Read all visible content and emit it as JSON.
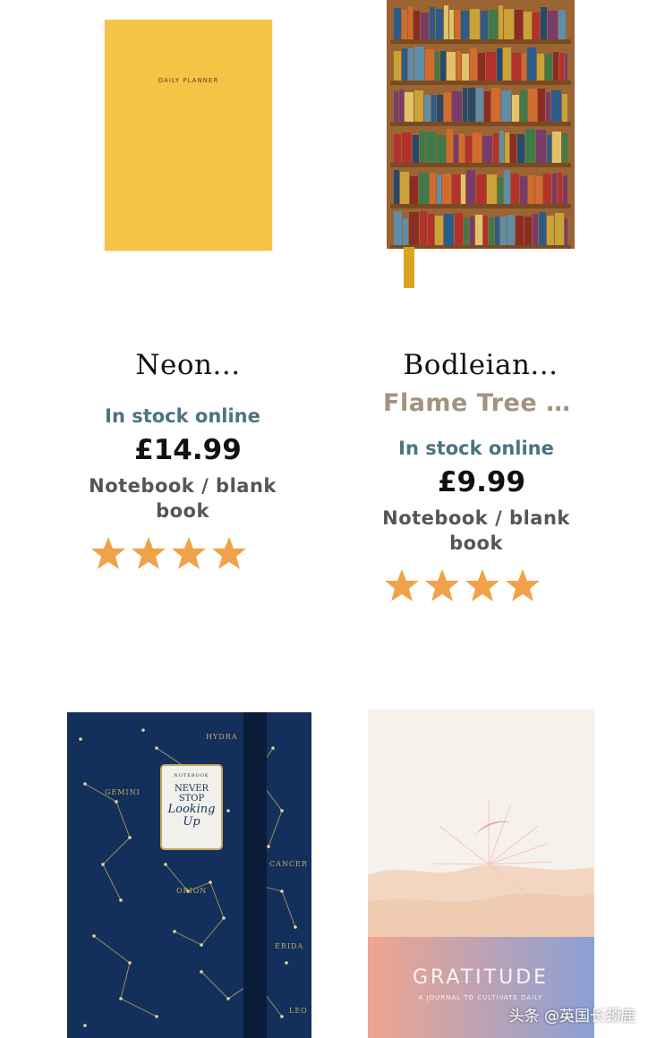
{
  "products": [
    {
      "title": "Neon...",
      "author": "",
      "stock": "In stock online",
      "price": "£14.99",
      "format": "Notebook / blank book",
      "rating": 4.5,
      "cover_text": "DAILY PLANNER"
    },
    {
      "title": "Bodleian...",
      "author": "Flame Tree St…",
      "stock": "In stock online",
      "price": "£9.99",
      "format": "Notebook / blank book",
      "rating": 4.5
    },
    {
      "cover_lines": [
        "NOTEBOOK",
        "NEVER",
        "STOP",
        "Looking",
        "Up"
      ],
      "constellations": [
        "HYDRA",
        "GEMINI",
        "CANCER",
        "ORION",
        "ERIDA",
        "LEO"
      ]
    },
    {
      "cover_title": "GRATITUDE",
      "cover_sub": "A JOURNAL TO CULTIVATE DAILY"
    }
  ],
  "colors": {
    "star": "#f0a24a",
    "stock": "#4a7480",
    "author": "#a3937e"
  },
  "watermark": "头条 @英国长颈鹿"
}
